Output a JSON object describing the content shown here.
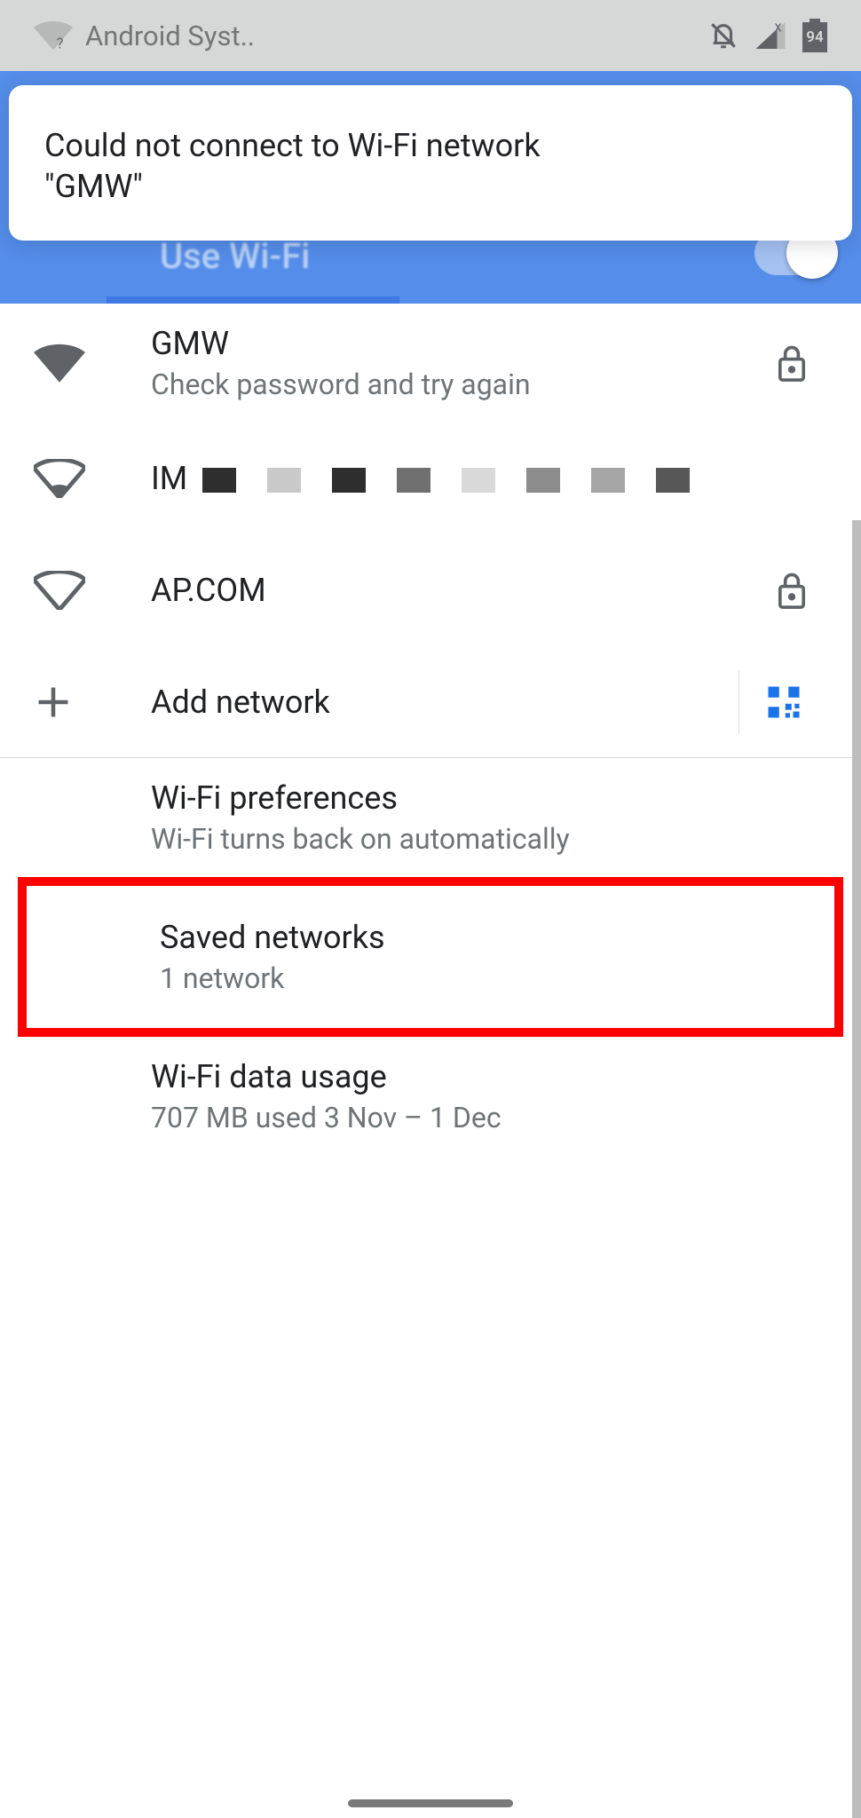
{
  "status": {
    "notif_app": "Android Syst..",
    "battery": "94"
  },
  "blue": {
    "title": "Use Wi-Fi"
  },
  "toast": {
    "line1": "Could not connect to Wi-Fi network",
    "line2": "\"GMW\""
  },
  "networks": [
    {
      "ssid": "GMW",
      "status": "Check password and try again",
      "signal": "full",
      "locked": true
    },
    {
      "ssid": "IM",
      "status": "",
      "signal": "low",
      "locked": false,
      "redacted": true
    },
    {
      "ssid": "AP.COM",
      "status": "",
      "signal": "none",
      "locked": true
    }
  ],
  "add_network": {
    "label": "Add network"
  },
  "prefs": {
    "wifi_pref_title": "Wi-Fi preferences",
    "wifi_pref_sub": "Wi-Fi turns back on automatically",
    "saved_title": "Saved networks",
    "saved_sub": "1 network",
    "usage_title": "Wi-Fi data usage",
    "usage_sub": "707 MB used 3 Nov – 1 Dec"
  }
}
